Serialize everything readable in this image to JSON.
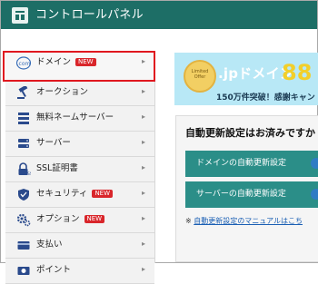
{
  "header": {
    "title": "コントロールパネル"
  },
  "sidebar": {
    "items": [
      {
        "label": "ドメイン",
        "badge": "NEW",
        "icon": "dotcom-icon"
      },
      {
        "label": "オークション",
        "badge": "",
        "icon": "gavel-icon"
      },
      {
        "label": "無料ネームサーバー",
        "badge": "",
        "icon": "server-stack-icon"
      },
      {
        "label": "サーバー",
        "badge": "",
        "icon": "server-icon"
      },
      {
        "label": "SSL証明書",
        "badge": "",
        "icon": "lock-icon"
      },
      {
        "label": "セキュリティ",
        "badge": "NEW",
        "icon": "shield-icon"
      },
      {
        "label": "オプション",
        "badge": "NEW",
        "icon": "gear-icon"
      },
      {
        "label": "支払い",
        "badge": "",
        "icon": "card-icon"
      },
      {
        "label": "ポイント",
        "badge": "",
        "icon": "points-icon"
      }
    ]
  },
  "banner": {
    "badge_text": "Limited Offer",
    "title": ".jpドメイン",
    "price": "88",
    "subtitle": "150万件突破！感謝キャン"
  },
  "panel": {
    "title": "自動更新設定はお済みですか",
    "domain_button": "ドメインの自動更新設定",
    "server_button": "サーバーの自動更新設定",
    "note_prefix": "※ ",
    "note_link": "自動更新設定のマニュアルはこち"
  },
  "colors": {
    "header_bg": "#1d6e66",
    "button_bg": "#2b8e88",
    "new_badge": "#d9262b",
    "highlight": "#e0181f",
    "banner_bg": "#b8e8f6"
  }
}
